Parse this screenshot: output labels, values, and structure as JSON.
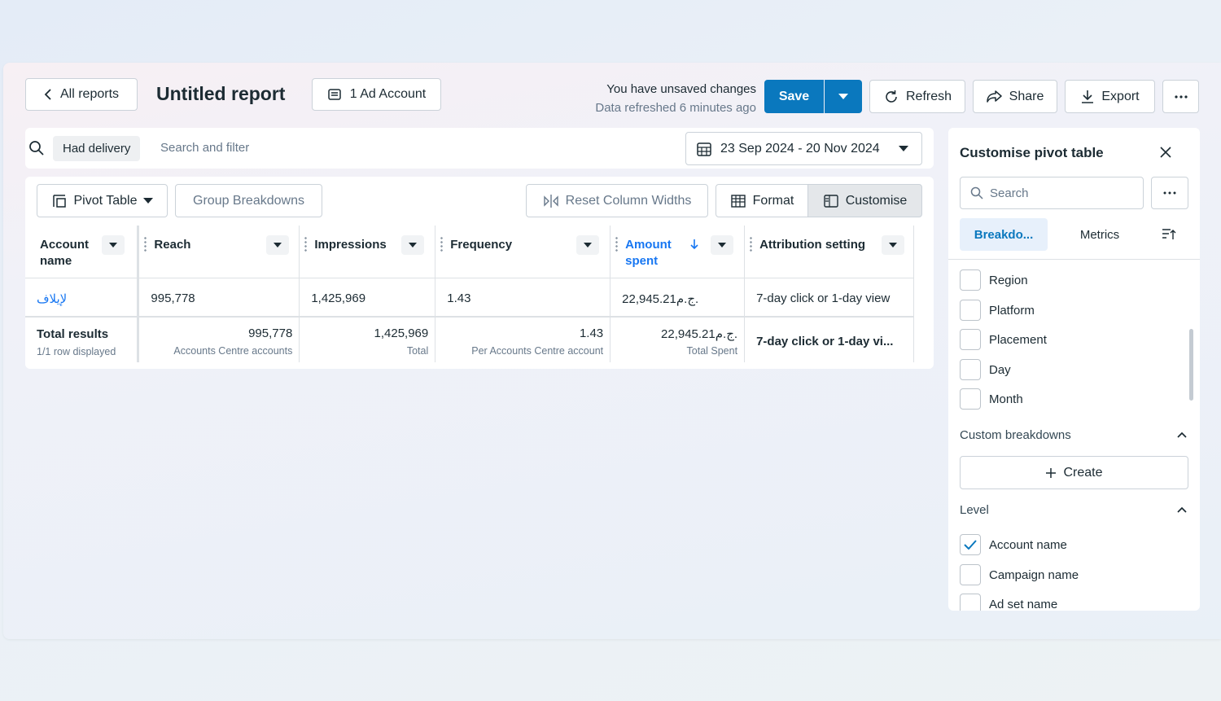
{
  "header": {
    "back_label": "All reports",
    "title": "Untitled report",
    "ad_account_label": "1 Ad Account",
    "unsaved_text": "You have unsaved changes",
    "refreshed_text": "Data refreshed 6 minutes ago",
    "save_label": "Save",
    "refresh_label": "Refresh",
    "share_label": "Share",
    "export_label": "Export"
  },
  "filter": {
    "chip_label": "Had delivery",
    "search_placeholder": "Search and filter",
    "date_range": "23 Sep 2024 - 20 Nov 2024"
  },
  "toolbar": {
    "view_label": "Pivot Table",
    "group_label": "Group Breakdowns",
    "reset_label": "Reset Column Widths",
    "format_label": "Format",
    "customise_label": "Customise"
  },
  "table": {
    "columns": [
      {
        "label": "Account\nname"
      },
      {
        "label": "Reach"
      },
      {
        "label": "Impressions"
      },
      {
        "label": "Frequency"
      },
      {
        "label": "Amount\nspent",
        "sorted": "desc"
      },
      {
        "label": "Attribution setting"
      }
    ],
    "row": {
      "account": "لإيلاف",
      "reach": "995,778",
      "impressions": "1,425,969",
      "frequency": "1.43",
      "amount": "22,945.21ج.م.",
      "attribution": "7-day click or 1-day view"
    },
    "total": {
      "label": "Total results",
      "sub": "1/1 row displayed",
      "reach": "995,778",
      "reach_sub": "Accounts Centre accounts",
      "impressions": "1,425,969",
      "impressions_sub": "Total",
      "frequency": "1.43",
      "frequency_sub": "Per Accounts Centre account",
      "amount": "22,945.21ج.م.",
      "amount_sub": "Total Spent",
      "attribution": "7-day click or 1-day vi..."
    }
  },
  "sidebar": {
    "title": "Customise pivot table",
    "search_placeholder": "Search",
    "tab_breakdowns": "Breakdo...",
    "tab_metrics": "Metrics",
    "breakdowns": [
      "Region",
      "Platform",
      "Placement",
      "Day",
      "Month"
    ],
    "custom_section": "Custom breakdowns",
    "create_label": "Create",
    "level_section": "Level",
    "levels": [
      {
        "label": "Account name",
        "checked": true
      },
      {
        "label": "Campaign name",
        "checked": false
      },
      {
        "label": "Ad set name",
        "checked": false
      }
    ]
  },
  "colors": {
    "primary": "#0a78be",
    "link": "#1877f2",
    "tab_bg": "#e7f0fb"
  }
}
